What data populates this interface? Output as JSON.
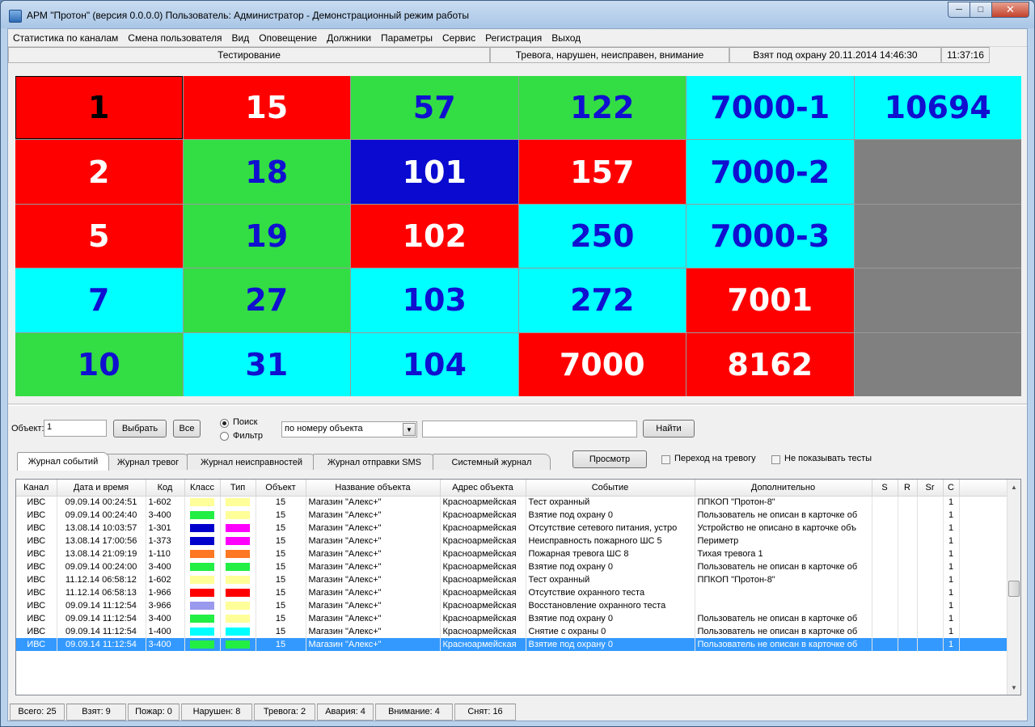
{
  "window": {
    "title": "АРМ \"Протон\" (версия 0.0.0.0)    Пользователь: Администратор - Демонстрационный режим работы"
  },
  "menu": [
    "Статистика по каналам",
    "Смена пользователя",
    "Вид",
    "Оповещение",
    "Должники",
    "Параметры",
    "Сервис",
    "Регистрация",
    "Выход"
  ],
  "top_status": {
    "mode": "Тестирование",
    "states": "Тревога, нарушен, неисправен, внимание",
    "armed": "Взят под охрану 20.11.2014 14:46:30",
    "time": "11:37:16"
  },
  "colors": {
    "red": "#ff0000",
    "green": "#33dd44",
    "cyan": "#00ffff",
    "blue": "#0a0ad0",
    "gray": "#808080",
    "selected_row": "#3399ff"
  },
  "grid": [
    {
      "label": "1",
      "bg": "red",
      "fg": "#000000"
    },
    {
      "label": "15",
      "bg": "red",
      "fg": "#ffffff"
    },
    {
      "label": "57",
      "bg": "green",
      "fg": "#1010d0"
    },
    {
      "label": "122",
      "bg": "green",
      "fg": "#1010d0"
    },
    {
      "label": "7000-1",
      "bg": "cyan",
      "fg": "#1010d0"
    },
    {
      "label": "10694",
      "bg": "cyan",
      "fg": "#1010d0"
    },
    {
      "label": "2",
      "bg": "red",
      "fg": "#ffffff"
    },
    {
      "label": "18",
      "bg": "green",
      "fg": "#1010d0"
    },
    {
      "label": "101",
      "bg": "blue",
      "fg": "#ffffff"
    },
    {
      "label": "157",
      "bg": "red",
      "fg": "#ffffff"
    },
    {
      "label": "7000-2",
      "bg": "cyan",
      "fg": "#1010d0"
    },
    {
      "label": "",
      "bg": "gray",
      "fg": "#000000"
    },
    {
      "label": "5",
      "bg": "red",
      "fg": "#ffffff"
    },
    {
      "label": "19",
      "bg": "green",
      "fg": "#1010d0"
    },
    {
      "label": "102",
      "bg": "red",
      "fg": "#ffffff"
    },
    {
      "label": "250",
      "bg": "cyan",
      "fg": "#1010d0"
    },
    {
      "label": "7000-3",
      "bg": "cyan",
      "fg": "#1010d0"
    },
    {
      "label": "",
      "bg": "gray",
      "fg": "#000000"
    },
    {
      "label": "7",
      "bg": "cyan",
      "fg": "#1010d0"
    },
    {
      "label": "27",
      "bg": "green",
      "fg": "#1010d0"
    },
    {
      "label": "103",
      "bg": "cyan",
      "fg": "#1010d0"
    },
    {
      "label": "272",
      "bg": "cyan",
      "fg": "#1010d0"
    },
    {
      "label": "7001",
      "bg": "red",
      "fg": "#ffffff"
    },
    {
      "label": "",
      "bg": "gray",
      "fg": "#000000"
    },
    {
      "label": "10",
      "bg": "green",
      "fg": "#1010d0"
    },
    {
      "label": "31",
      "bg": "cyan",
      "fg": "#1010d0"
    },
    {
      "label": "104",
      "bg": "cyan",
      "fg": "#1010d0"
    },
    {
      "label": "7000",
      "bg": "red",
      "fg": "#ffffff"
    },
    {
      "label": "8162",
      "bg": "red",
      "fg": "#ffffff"
    },
    {
      "label": "",
      "bg": "gray",
      "fg": "#000000"
    }
  ],
  "controls": {
    "object_label": "Объект:",
    "object_value": "1",
    "select_button": "Выбрать",
    "all_button": "Все",
    "radio_search": "Поиск",
    "radio_filter": "Фильтр",
    "search_mode": "по номеру объекта",
    "search_text": "",
    "find_button": "Найти"
  },
  "tabs": [
    "Журнал событий",
    "Журнал тревог",
    "Журнал неисправностей",
    "Журнал отправки SMS",
    "Системный журнал"
  ],
  "view_button": "Просмотр",
  "checkbox_goto_alarm": "Переход на тревогу",
  "checkbox_hide_tests": "Не показывать тесты",
  "table": {
    "columns": [
      "Канал",
      "Дата и время",
      "Код",
      "Класс",
      "Тип",
      "Объект",
      "Название объекта",
      "Адрес объекта",
      "Событие",
      "Дополнительно",
      "S",
      "R",
      "Sr",
      "C"
    ],
    "rows": [
      {
        "channel": "ИВС",
        "date": "09.09.14  00:24:51",
        "code": "1-602",
        "cls": "#ffff99",
        "typ": "#ffff99",
        "obj": "15",
        "name": "Магазин \"Алекс+\"",
        "addr": "Красноармейская",
        "event": "Тест охранный",
        "extra": "ППКОП \"Протон-8\"",
        "c": "1"
      },
      {
        "channel": "ИВС",
        "date": "09.09.14  00:24:40",
        "code": "3-400",
        "cls": "#22ee44",
        "typ": "#ffff99",
        "obj": "15",
        "name": "Магазин \"Алекс+\"",
        "addr": "Красноармейская",
        "event": "Взятие под охрану 0",
        "extra": "Пользователь не описан в карточке об",
        "c": "1"
      },
      {
        "channel": "ИВС",
        "date": "13.08.14  10:03:57",
        "code": "1-301",
        "cls": "#0000cc",
        "typ": "#ff00ff",
        "obj": "15",
        "name": "Магазин \"Алекс+\"",
        "addr": "Красноармейская",
        "event": "Отсутствие сетевого питания, устро",
        "extra": "Устройство не описано в карточке объ",
        "c": "1"
      },
      {
        "channel": "ИВС",
        "date": "13.08.14  17:00:56",
        "code": "1-373",
        "cls": "#0000cc",
        "typ": "#ff00ff",
        "obj": "15",
        "name": "Магазин \"Алекс+\"",
        "addr": "Красноармейская",
        "event": "Неисправность пожарного ШС 5",
        "extra": "Периметр",
        "c": "1"
      },
      {
        "channel": "ИВС",
        "date": "13.08.14  21:09:19",
        "code": "1-110",
        "cls": "#ff7722",
        "typ": "#ff7722",
        "obj": "15",
        "name": "Магазин \"Алекс+\"",
        "addr": "Красноармейская",
        "event": "Пожарная тревога ШС 8",
        "extra": "Тихая тревога 1",
        "c": "1"
      },
      {
        "channel": "ИВС",
        "date": "09.09.14  00:24:00",
        "code": "3-400",
        "cls": "#22ee44",
        "typ": "#22ee44",
        "obj": "15",
        "name": "Магазин \"Алекс+\"",
        "addr": "Красноармейская",
        "event": "Взятие под охрану 0",
        "extra": "Пользователь не описан в карточке об",
        "c": "1"
      },
      {
        "channel": "ИВС",
        "date": "11.12.14  06:58:12",
        "code": "1-602",
        "cls": "#ffff99",
        "typ": "#ffff99",
        "obj": "15",
        "name": "Магазин \"Алекс+\"",
        "addr": "Красноармейская",
        "event": "Тест охранный",
        "extra": "ППКОП \"Протон-8\"",
        "c": "1"
      },
      {
        "channel": "ИВС",
        "date": "11.12.14  06:58:13",
        "code": "1-966",
        "cls": "#ff0000",
        "typ": "#ff0000",
        "obj": "15",
        "name": "Магазин \"Алекс+\"",
        "addr": "Красноармейская",
        "event": "Отсутствие охранного теста",
        "extra": "",
        "c": "1"
      },
      {
        "channel": "ИВС",
        "date": "09.09.14  11:12:54",
        "code": "3-966",
        "cls": "#9999ee",
        "typ": "#ffff99",
        "obj": "15",
        "name": "Магазин \"Алекс+\"",
        "addr": "Красноармейская",
        "event": "Восстановление охранного теста",
        "extra": "",
        "c": "1"
      },
      {
        "channel": "ИВС",
        "date": "09.09.14  11:12:54",
        "code": "3-400",
        "cls": "#22ee44",
        "typ": "#ffff99",
        "obj": "15",
        "name": "Магазин \"Алекс+\"",
        "addr": "Красноармейская",
        "event": "Взятие под охрану 0",
        "extra": "Пользователь не описан в карточке об",
        "c": "1"
      },
      {
        "channel": "ИВС",
        "date": "09.09.14  11:12:54",
        "code": "1-400",
        "cls": "#00ffff",
        "typ": "#00ffff",
        "obj": "15",
        "name": "Магазин \"Алекс+\"",
        "addr": "Красноармейская",
        "event": "Снятие с охраны 0",
        "extra": "Пользователь не описан в карточке об",
        "c": "1"
      },
      {
        "channel": "ИВС",
        "date": "09.09.14  11:12:54",
        "code": "3-400",
        "cls": "#22ee44",
        "typ": "#22ee44",
        "obj": "15",
        "name": "Магазин \"Алекс+\"",
        "addr": "Красноармейская",
        "event": "Взятие под охрану 0",
        "extra": "Пользователь не описан в карточке об",
        "c": "1",
        "selected": true
      }
    ]
  },
  "bottom_status": [
    "Всего: 25",
    "Взят: 9",
    "Пожар: 0",
    "Нарушен: 8",
    "Тревога: 2",
    "Авария: 4",
    "Внимание: 4",
    "Снят: 16"
  ]
}
